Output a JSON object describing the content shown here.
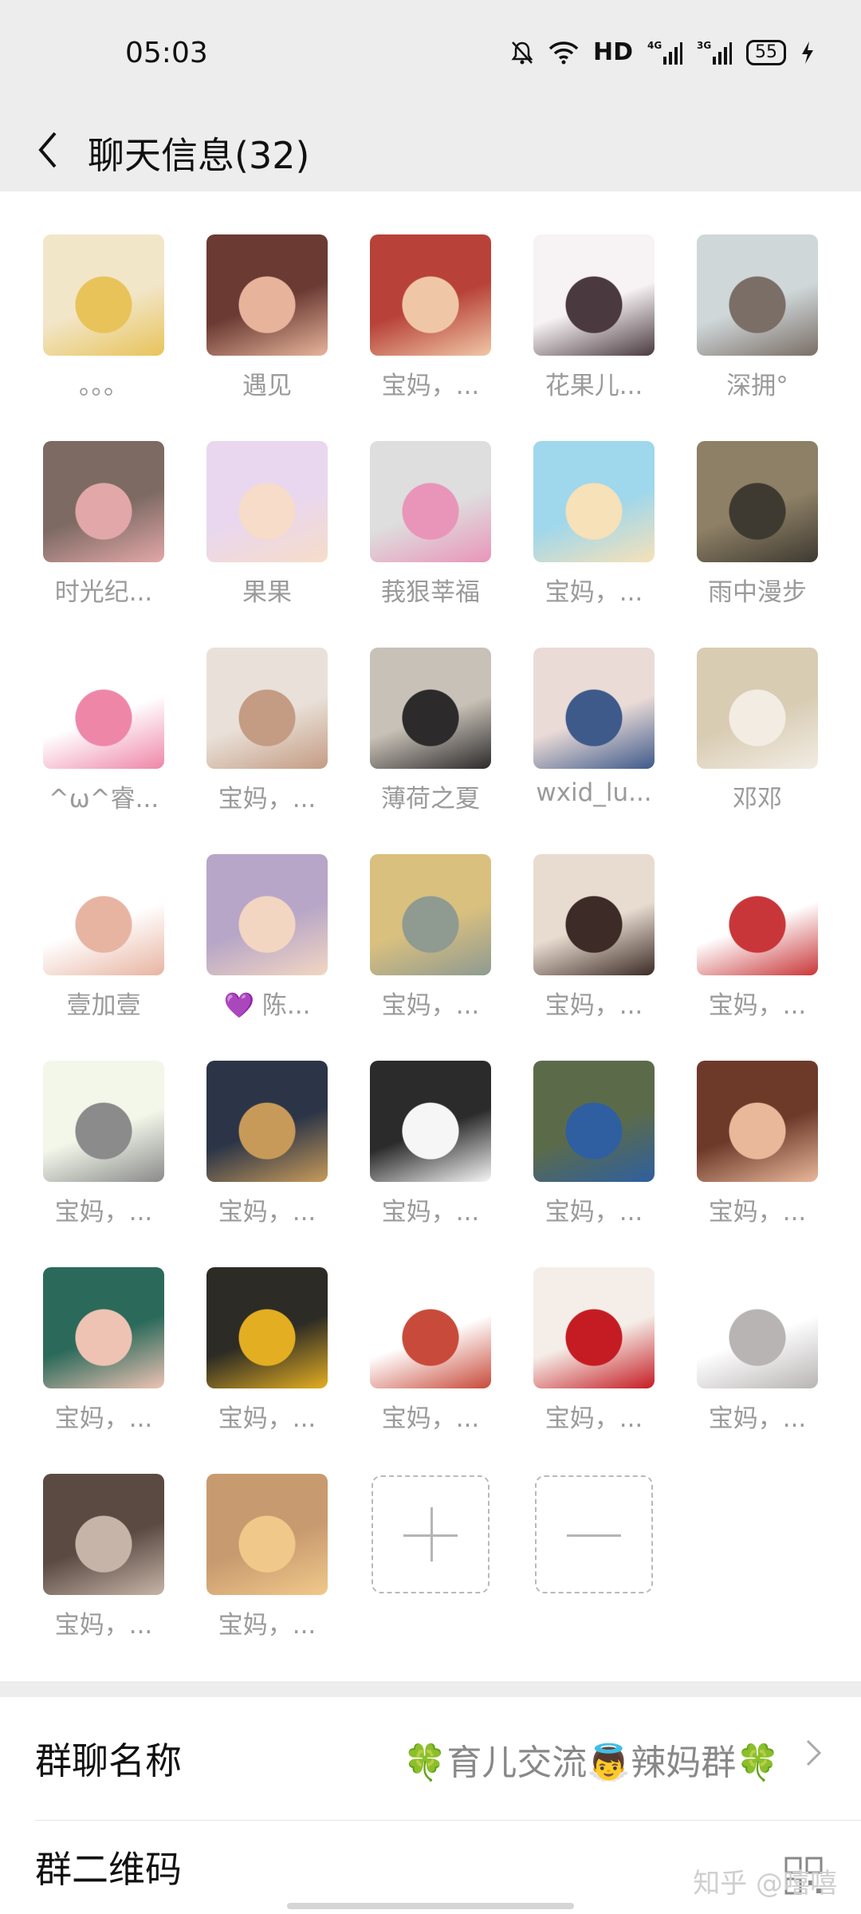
{
  "status_bar": {
    "time": "05:03",
    "network": "HD",
    "battery": "55"
  },
  "header": {
    "title": "聊天信息(32)"
  },
  "members": [
    {
      "name": "。。。",
      "colors": [
        "#f2e6c9",
        "#e8c35a"
      ]
    },
    {
      "name": "遇见",
      "colors": [
        "#6b3a33",
        "#e7b49b"
      ]
    },
    {
      "name": "宝妈，...",
      "colors": [
        "#b8423a",
        "#f0c7a6"
      ]
    },
    {
      "name": "花果儿...",
      "colors": [
        "#f7f2f4",
        "#4a3a3f"
      ]
    },
    {
      "name": "深拥°",
      "colors": [
        "#cfd7d9",
        "#7a6e66"
      ]
    },
    {
      "name": "时光纪...",
      "colors": [
        "#7d6a63",
        "#e2a7a8"
      ]
    },
    {
      "name": "果果",
      "colors": [
        "#e9d7ef",
        "#f6dcc9"
      ]
    },
    {
      "name": "莪狠莘福",
      "colors": [
        "#dedede",
        "#e995b9"
      ]
    },
    {
      "name": "宝妈，...",
      "colors": [
        "#9fd7ec",
        "#f6e1b8"
      ]
    },
    {
      "name": "雨中漫步",
      "colors": [
        "#8e8066",
        "#3e3a31"
      ]
    },
    {
      "name": "^ω^睿...",
      "colors": [
        "#ffffff",
        "#ee86a8"
      ]
    },
    {
      "name": "宝妈，...",
      "colors": [
        "#e9e1d9",
        "#c49b83"
      ]
    },
    {
      "name": "薄荷之夏",
      "colors": [
        "#c8c1b7",
        "#2c2a2b"
      ]
    },
    {
      "name": "wxid_lu...",
      "colors": [
        "#eadbd7",
        "#3e5a8a"
      ]
    },
    {
      "name": "邓邓",
      "colors": [
        "#d8ccb3",
        "#f2ece3"
      ]
    },
    {
      "name": "壹加壹",
      "colors": [
        "#ffffff",
        "#e8b4a2"
      ]
    },
    {
      "name": "💜 陈...",
      "colors": [
        "#b7a6c7",
        "#f2d6c2"
      ]
    },
    {
      "name": "宝妈，...",
      "colors": [
        "#d9c07f",
        "#8f9a91"
      ]
    },
    {
      "name": "宝妈，...",
      "colors": [
        "#e8dcd0",
        "#3c2b26"
      ]
    },
    {
      "name": "宝妈，...",
      "colors": [
        "#ffffff",
        "#c93639"
      ]
    },
    {
      "name": "宝妈，...",
      "colors": [
        "#f2f7ea",
        "#8b8b8b"
      ]
    },
    {
      "name": "宝妈，...",
      "colors": [
        "#2c3547",
        "#c79a5a"
      ]
    },
    {
      "name": "宝妈，...",
      "colors": [
        "#2b2b2b",
        "#f6f6f6"
      ]
    },
    {
      "name": "宝妈，...",
      "colors": [
        "#5b6b4a",
        "#2f5fa0"
      ]
    },
    {
      "name": "宝妈，...",
      "colors": [
        "#6d3a2a",
        "#e9b79a"
      ]
    },
    {
      "name": "宝妈，...",
      "colors": [
        "#2b6a5a",
        "#efc3b4"
      ]
    },
    {
      "name": "宝妈，...",
      "colors": [
        "#2c2b25",
        "#e4ae22"
      ]
    },
    {
      "name": "宝妈，...",
      "colors": [
        "#ffffff",
        "#c84a3a"
      ]
    },
    {
      "name": "宝妈，...",
      "colors": [
        "#f5eee8",
        "#c51c23"
      ]
    },
    {
      "name": "宝妈，...",
      "colors": [
        "#ffffff",
        "#b9b4b4"
      ]
    },
    {
      "name": "宝妈，...",
      "colors": [
        "#5a4a42",
        "#c7b4a8"
      ]
    },
    {
      "name": "宝妈，...",
      "colors": [
        "#c89a6f",
        "#f0c98a"
      ]
    }
  ],
  "settings": {
    "group_name_label": "群聊名称",
    "group_name_value": "🍀育儿交流👼辣妈群🍀",
    "qr_label": "群二维码"
  },
  "watermark": "知乎 @嘻嘻"
}
